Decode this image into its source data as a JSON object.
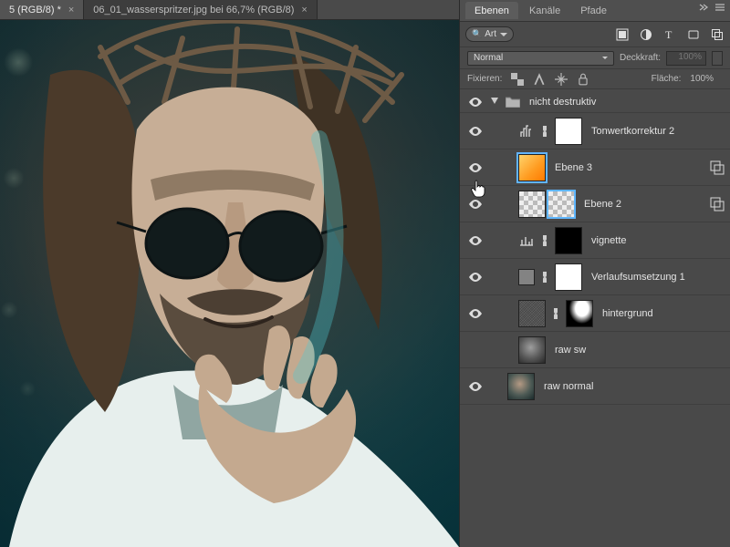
{
  "tabs": [
    {
      "label": "5 (RGB/8) *",
      "active": true
    },
    {
      "label": "06_01_wasserspritzer.jpg bei 66,7% (RGB/8)",
      "active": false
    }
  ],
  "panel": {
    "tabs": {
      "layers": "Ebenen",
      "channels": "Kanäle",
      "paths": "Pfade",
      "active": "layers"
    },
    "filter": {
      "icon": "🔍",
      "label": "Art"
    },
    "blend_mode": "Normal",
    "opacity": {
      "label": "Deckkraft:",
      "value": "100%"
    },
    "lock": {
      "label": "Fixieren:"
    },
    "fill": {
      "label": "Fläche:",
      "value": "100%"
    },
    "group": {
      "name": "nicht destruktiv",
      "expanded": true
    },
    "layers": [
      {
        "kind": "adjustment-levels",
        "name": "Tonwertkorrektur 2",
        "mask": "white",
        "linked": true
      },
      {
        "kind": "pixel",
        "name": "Ebene 3",
        "thumb": "orange",
        "selected": true,
        "smart": true
      },
      {
        "kind": "pixel",
        "name": "Ebene 2",
        "thumb": "checker",
        "mask": "ebene2",
        "smart": true
      },
      {
        "kind": "adjustment-generic",
        "name": "vignette",
        "mask": "black",
        "linked": true
      },
      {
        "kind": "adjustment-gradmap",
        "name": "Verlaufsumsetzung 1",
        "thumb": "gray",
        "mask": "white",
        "linked": true
      },
      {
        "kind": "pixel",
        "name": "hintergrund",
        "thumb": "noise",
        "mask": "brushblack",
        "linked": true
      },
      {
        "kind": "pixel",
        "name": "raw sw",
        "thumb": "photo"
      },
      {
        "kind": "pixel",
        "name": "raw normal",
        "thumb": "photo",
        "indent": 0
      }
    ]
  }
}
